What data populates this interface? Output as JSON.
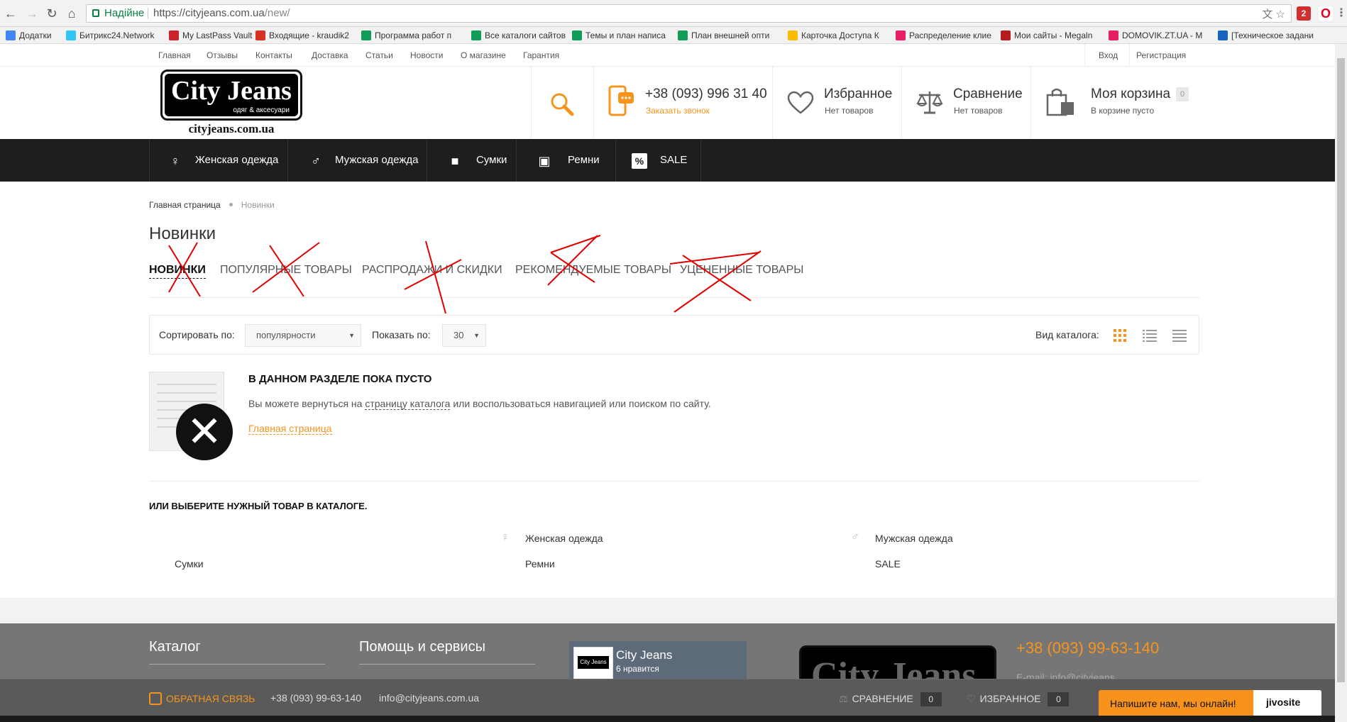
{
  "browser": {
    "secure_label": "Надійне",
    "url_host": "https://cityjeans.com.ua",
    "url_path": "/new/",
    "ext_badge": "2"
  },
  "bookmarks": [
    {
      "label": "Додатки",
      "color": "#4285f4"
    },
    {
      "label": "Битрикс24.Network",
      "color": "#2fc6f6"
    },
    {
      "label": "My LastPass Vault",
      "color": "#cc2128"
    },
    {
      "label": "Входящие - kraudik2",
      "color": "#d93025"
    },
    {
      "label": "Программа работ п",
      "color": "#0f9d58"
    },
    {
      "label": "Все каталоги сайтов",
      "color": "#0f9d58"
    },
    {
      "label": "Темы и план написа",
      "color": "#0f9d58"
    },
    {
      "label": "План внешней опти",
      "color": "#0f9d58"
    },
    {
      "label": "Карточка Доступа К",
      "color": "#fbbc04"
    },
    {
      "label": "Распределение клие",
      "color": "#e91e63"
    },
    {
      "label": "Мои сайты - Megaln",
      "color": "#b71c1c"
    },
    {
      "label": "DOMOVIK.ZT.UA - М",
      "color": "#e91e63"
    },
    {
      "label": "[Техническое задани",
      "color": "#1565c0"
    }
  ],
  "toplinks": {
    "items": [
      "Главная",
      "Отзывы",
      "Контакты",
      "Доставка",
      "Статьи",
      "Новости",
      "О магазине",
      "Гарантия"
    ],
    "login": "Вход",
    "register": "Регистрация"
  },
  "logo": {
    "title": "City Jeans",
    "subtitle": "одяг & аксесуари",
    "url": "cityjeans.com.ua"
  },
  "header": {
    "phone": "+38 (093) 996 31 40",
    "callback": "Заказать звонок",
    "favorites_title": "Избранное",
    "favorites_sub": "Нет товаров",
    "compare_title": "Сравнение",
    "compare_sub": "Нет товаров",
    "cart_title": "Моя корзина",
    "cart_count": "0",
    "cart_sub": "В корзине пусто"
  },
  "menu": [
    {
      "label": "Женская одежда",
      "icon": "woman-icon"
    },
    {
      "label": "Мужская одежда",
      "icon": "man-icon"
    },
    {
      "label": "Сумки",
      "icon": "bag-icon"
    },
    {
      "label": "Ремни",
      "icon": "belt-icon"
    },
    {
      "label": "SALE",
      "icon": "percent-icon"
    }
  ],
  "breadcrumbs": {
    "home": "Главная страница",
    "current": "Новинки"
  },
  "page_title": "Новинки",
  "tabs": [
    "НОВИНКИ",
    "ПОПУЛЯРНЫЕ ТОВАРЫ",
    "РАСПРОДАЖИ И СКИДКИ",
    "РЕКОМЕНДУЕМЫЕ ТОВАРЫ",
    "УЦЕНЕННЫЕ ТОВАРЫ"
  ],
  "filter": {
    "sort_label": "Сортировать по:",
    "sort_value": "популярности",
    "show_label": "Показать по:",
    "show_value": "30",
    "view_label": "Вид каталога:"
  },
  "empty": {
    "title": "В ДАННОМ РАЗДЕЛЕ ПОКА ПУСТО",
    "text_before": "Вы можете вернуться на ",
    "text_link": "страницу каталога",
    "text_after": " или воспользоваться навигацией или поиском по сайту.",
    "home_link": "Главная страница"
  },
  "choose": {
    "title": "ИЛИ ВЫБЕРИТЕ НУЖНЫЙ ТОВАР В КАТАЛОГЕ.",
    "links": [
      "Женская одежда",
      "Мужская одежда",
      "Сумки",
      "Ремни",
      "SALE"
    ]
  },
  "footer": {
    "catalog": "Каталог",
    "help": "Помощь и сервисы",
    "fb_title": "City Jeans",
    "fb_likes": "6 нравится",
    "phone": "+38 (093) 99-63-140",
    "email_partial": "E-mail: info@cityjeans"
  },
  "bottom_bar": {
    "feedback": "ОБРАТНАЯ СВЯЗЬ",
    "phone": "+38 (093) 99-63-140",
    "email": "info@cityjeans.com.ua",
    "compare": "СРАВНЕНИЕ",
    "compare_count": "0",
    "favorites": "ИЗБРАННОЕ",
    "favorites_count": "0"
  },
  "jivo": {
    "text": "Напишите нам, мы онлайн!",
    "brand": "jivosite"
  },
  "colors": {
    "accent": "#f7941d",
    "menu_bg": "#1e1e1e",
    "annotation": "#e00000"
  }
}
